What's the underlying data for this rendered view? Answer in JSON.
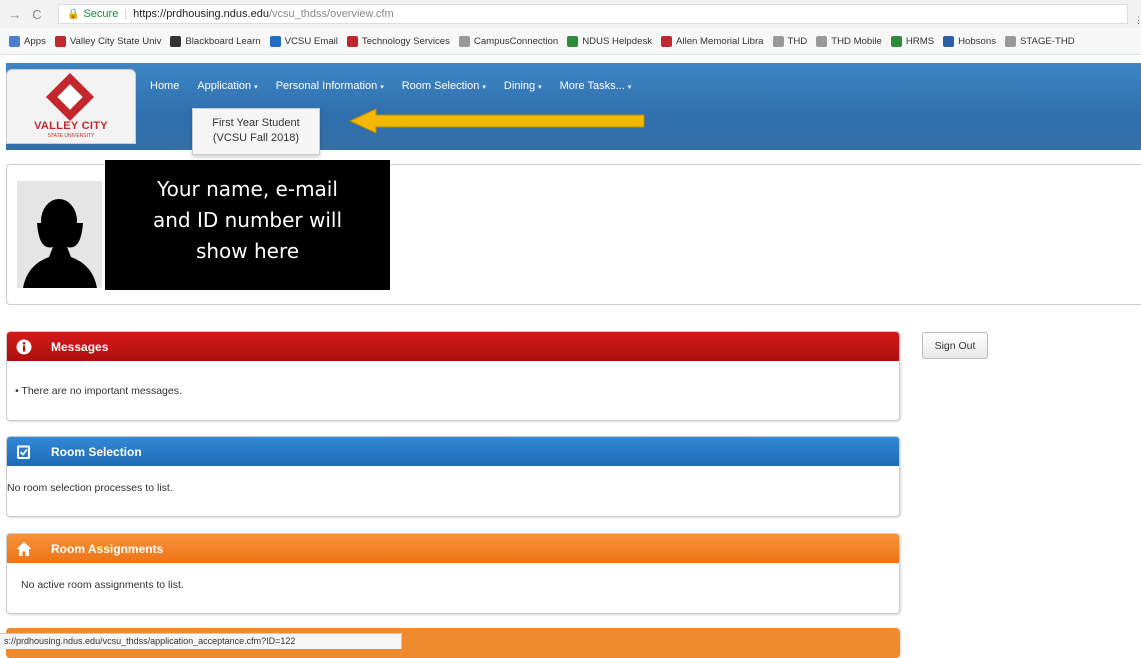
{
  "browser": {
    "secure_label": "Secure",
    "url_host": "https://prdhousing.ndus.edu",
    "url_path": "/vcsu_thdss/overview.cfm",
    "bookmarks": [
      {
        "label": "Apps",
        "icon": "apps-grid-icon",
        "color": "#4a7fd0"
      },
      {
        "label": "Valley City State Univ",
        "icon": "vcsu-logo-icon",
        "color": "#c2272d"
      },
      {
        "label": "Blackboard Learn",
        "icon": "blackboard-icon",
        "color": "#333333"
      },
      {
        "label": "VCSU Email",
        "icon": "outlook-icon",
        "color": "#1f6cc2"
      },
      {
        "label": "Technology Services",
        "icon": "vcsu-logo-icon",
        "color": "#c2272d"
      },
      {
        "label": "CampusConnection",
        "icon": "page-icon",
        "color": "#999999"
      },
      {
        "label": "NDUS Helpdesk",
        "icon": "ndus-icon",
        "color": "#2e8b3a"
      },
      {
        "label": "Allen Memorial Libra",
        "icon": "vcsu-logo-icon",
        "color": "#c2272d"
      },
      {
        "label": "THD",
        "icon": "page-icon",
        "color": "#999999"
      },
      {
        "label": "THD Mobile",
        "icon": "page-icon",
        "color": "#999999"
      },
      {
        "label": "HRMS",
        "icon": "ndus-icon",
        "color": "#2e8b3a"
      },
      {
        "label": "Hobsons",
        "icon": "hobsons-icon",
        "color": "#2a5ea8"
      },
      {
        "label": "STAGE-THD",
        "icon": "page-icon",
        "color": "#999999"
      }
    ],
    "status_url": "s://prdhousing.ndus.edu/vcsu_thdss/application_acceptance.cfm?ID=122"
  },
  "logo": {
    "name": "VALLEY CITY",
    "sub": "STATE UNIVERSITY"
  },
  "menu": [
    {
      "label": "Home",
      "has_caret": false
    },
    {
      "label": "Application",
      "has_caret": true
    },
    {
      "label": "Personal Information",
      "has_caret": true
    },
    {
      "label": "Room Selection",
      "has_caret": true
    },
    {
      "label": "Dining",
      "has_caret": true
    },
    {
      "label": "More Tasks...",
      "has_caret": true
    }
  ],
  "dropdown": {
    "line1": "First Year Student",
    "line2": "(VCSU Fall 2018)"
  },
  "annotation": {
    "line1": "Your name, e-mail",
    "line2": "and ID number will",
    "line3": "show here",
    "arrow_color": "#f5b800"
  },
  "panels": {
    "messages": {
      "title": "Messages",
      "body": "• There are no important messages.",
      "color": "#c41414"
    },
    "room_selection": {
      "title": "Room Selection",
      "body": "No room selection processes to list.",
      "color": "#2a7cc9"
    },
    "room_assignments": {
      "title": "Room Assignments",
      "body": "No active room assignments to list.",
      "color": "#f2801f"
    }
  },
  "signout_label": "Sign Out"
}
